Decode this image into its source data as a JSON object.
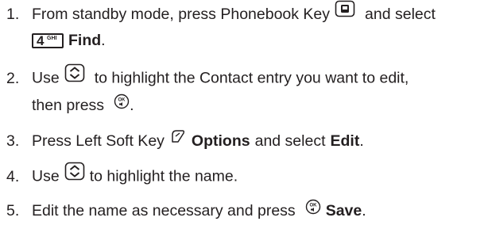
{
  "steps": [
    {
      "number": "1.",
      "line1_text": "From standby mode, press Phonebook Key",
      "line1_after": "and select",
      "line2_key_digit": "4",
      "line2_key_letters": "GHI",
      "line2_bold": "Find",
      "line2_end": "."
    },
    {
      "number": "2.",
      "line1_before": "Use",
      "line1_after": "to highlight the Contact entry you want to edit,",
      "line2_text": "then press",
      "line2_end": "."
    },
    {
      "number": "3.",
      "text_before": "Press Left Soft Key",
      "bold1": "Options",
      "text_middle": "and select",
      "bold2": "Edit",
      "text_end": "."
    },
    {
      "number": "4.",
      "text_before": "Use",
      "text_after": "to highlight the name."
    },
    {
      "number": "5.",
      "text_before": "Edit the name as necessary and press",
      "bold": "Save",
      "text_end": "."
    }
  ],
  "icons": {
    "phonebook_key": "phonebook-key-icon",
    "nav_key": "up-down-navigation-key-icon",
    "ok_key": "ok-key-icon",
    "left_soft_key": "left-soft-key-icon"
  },
  "colors": {
    "text": "#231f20"
  }
}
